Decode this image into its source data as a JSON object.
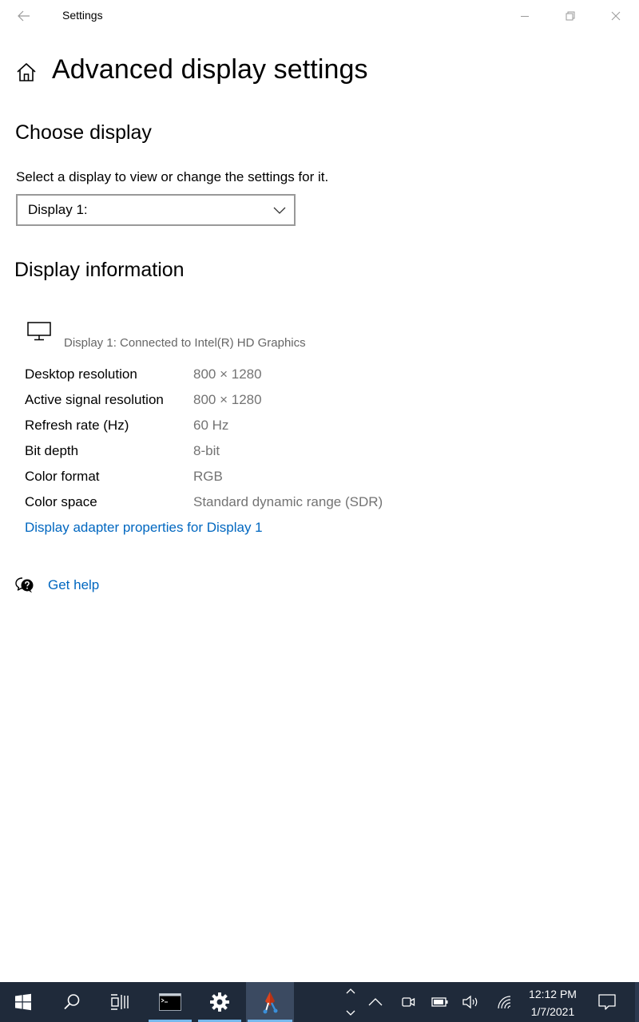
{
  "window": {
    "title": "Settings"
  },
  "page": {
    "title": "Advanced display settings"
  },
  "choose_display": {
    "heading": "Choose display",
    "description": "Select a display to view or change the settings for it.",
    "selected": "Display 1:"
  },
  "display_info": {
    "heading": "Display information",
    "connection": "Display 1: Connected to Intel(R) HD Graphics",
    "rows": [
      {
        "label": "Desktop resolution",
        "value": "800 × 1280"
      },
      {
        "label": "Active signal resolution",
        "value": "800 × 1280"
      },
      {
        "label": "Refresh rate (Hz)",
        "value": "60 Hz"
      },
      {
        "label": "Bit depth",
        "value": "8-bit"
      },
      {
        "label": "Color format",
        "value": "RGB"
      },
      {
        "label": "Color space",
        "value": "Standard dynamic range (SDR)"
      }
    ],
    "adapter_link": "Display adapter properties for Display 1"
  },
  "help": {
    "label": "Get help"
  },
  "taskbar": {
    "time": "12:12 PM",
    "date": "1/7/2021",
    "icons": [
      "windows-start-icon",
      "search-icon",
      "task-view-icon",
      "command-prompt-icon",
      "settings-gear-icon",
      "app-icon",
      "scroll-arrows-icon",
      "show-hidden-icons-icon",
      "meet-now-icon",
      "battery-icon",
      "volume-icon",
      "network-icon",
      "action-center-icon"
    ]
  },
  "colors": {
    "link": "#0067c0",
    "taskbar": "#1f2a3a",
    "accent_underline": "#76b9ed",
    "secondary_text": "#737373"
  }
}
